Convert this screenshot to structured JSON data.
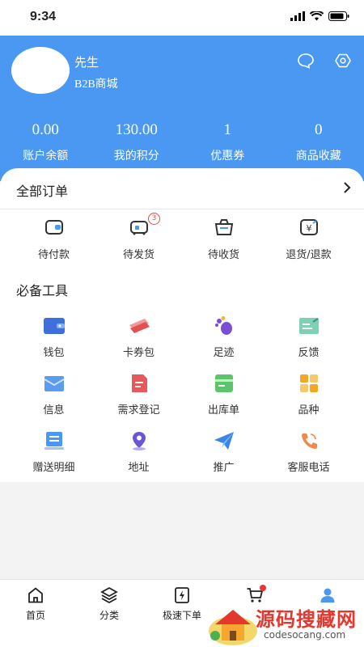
{
  "status": {
    "time": "9:34"
  },
  "profile": {
    "name": "先生",
    "shop": "B2B商城"
  },
  "stats": [
    {
      "value": "0.00",
      "label": "账户余额"
    },
    {
      "value": "130.00",
      "label": "我的积分"
    },
    {
      "value": "1",
      "label": "优惠券"
    },
    {
      "value": "0",
      "label": "商品收藏"
    }
  ],
  "orders": {
    "title": "全部订单",
    "items": [
      {
        "label": "待付款",
        "icon": "wallet-icon"
      },
      {
        "label": "待发货",
        "icon": "truck-icon",
        "badge": "3"
      },
      {
        "label": "待收货",
        "icon": "basket-icon"
      },
      {
        "label": "退货/退款",
        "icon": "refund-icon"
      }
    ]
  },
  "tools": {
    "title": "必备工具",
    "items": [
      {
        "label": "钱包",
        "icon": "wallet-icon"
      },
      {
        "label": "卡券包",
        "icon": "ticket-icon"
      },
      {
        "label": "足迹",
        "icon": "footprint-icon"
      },
      {
        "label": "反馈",
        "icon": "feedback-icon"
      },
      {
        "label": "信息",
        "icon": "mail-icon"
      },
      {
        "label": "需求登记",
        "icon": "document-icon"
      },
      {
        "label": "出库单",
        "icon": "form-icon"
      },
      {
        "label": "品种",
        "icon": "grid-icon"
      },
      {
        "label": "赠送明细",
        "icon": "list-icon"
      },
      {
        "label": "地址",
        "icon": "location-icon"
      },
      {
        "label": "推广",
        "icon": "send-icon"
      },
      {
        "label": "客服电话",
        "icon": "phone-icon"
      }
    ]
  },
  "nav": [
    {
      "label": "首页",
      "icon": "home-icon"
    },
    {
      "label": "分类",
      "icon": "layers-icon"
    },
    {
      "label": "极速下单",
      "icon": "lightning-icon"
    },
    {
      "label": "",
      "icon": "cart-icon"
    },
    {
      "label": "",
      "icon": "user-icon"
    }
  ],
  "watermark": {
    "title": "源码搜藏网",
    "sub": "codesocang.com"
  },
  "colors": {
    "brand": "#4a98f2",
    "badge": "#e44444"
  }
}
